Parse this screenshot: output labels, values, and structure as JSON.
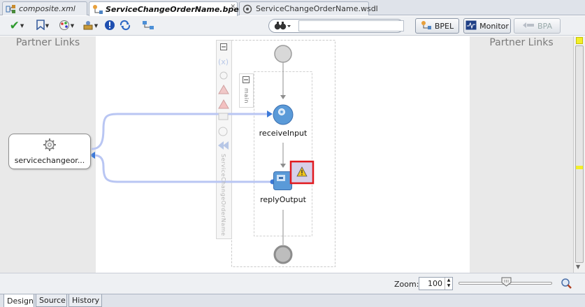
{
  "tabs": [
    {
      "label": "composite.xml",
      "icon": "composite-icon",
      "active": false
    },
    {
      "label": "ServiceChangeOrderName.bpel",
      "icon": "bpel-process-icon",
      "active": true
    },
    {
      "label": "ServiceChangeOrderName.wsdl",
      "icon": "wsdl-icon",
      "active": false
    }
  ],
  "toolbar": {
    "search_placeholder": "",
    "bpel_button": "BPEL",
    "monitor_button": "Monitor",
    "bpa_button": "BPA"
  },
  "canvas": {
    "left_panel_title": "Partner Links",
    "right_panel_title": "Partner Links",
    "partner_link_label": "servicechangeor...",
    "scope_label": "main",
    "process_name": "ServiceChangeOrderName",
    "activities": [
      {
        "name": "receiveInput",
        "type": "receive"
      },
      {
        "name": "replyOutput",
        "type": "reply",
        "warning": true
      }
    ]
  },
  "status": {
    "zoom_label": "Zoom:",
    "zoom_value": "100"
  },
  "view_tabs": [
    {
      "label": "Design",
      "active": true
    },
    {
      "label": "Source",
      "active": false
    },
    {
      "label": "History",
      "active": false
    }
  ],
  "colors": {
    "link_line": "#b9c6f3",
    "activity_blue": "#5a9ad8",
    "warning_border": "#e0191f",
    "scrollbar_marker": "#f2ef2a"
  }
}
